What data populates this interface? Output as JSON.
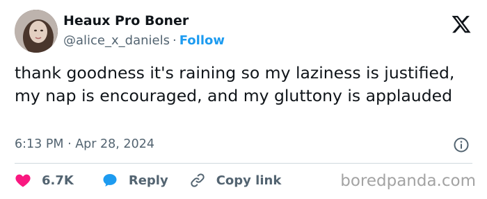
{
  "author": {
    "display_name": "Heaux Pro Boner",
    "handle": "@alice_x_daniels",
    "separator": "·",
    "follow_label": "Follow"
  },
  "tweet": {
    "text": "thank goodness it's raining so my laziness is justified, my nap is encouraged, and my gluttony is applauded",
    "timestamp": "6:13 PM · Apr 28, 2024"
  },
  "actions": {
    "likes": "6.7K",
    "reply_label": "Reply",
    "copy_link_label": "Copy link"
  },
  "watermark": "boredpanda.com",
  "colors": {
    "text": "#0f1419",
    "muted": "#536471",
    "link_blue": "#1d9bf0",
    "heart_pink": "#f91880",
    "divider": "#cfd9de"
  },
  "icons": {
    "brand": "x-logo-icon",
    "info": "info-icon",
    "like": "heart-icon",
    "reply": "chat-bubble-icon",
    "copy_link": "link-icon"
  }
}
